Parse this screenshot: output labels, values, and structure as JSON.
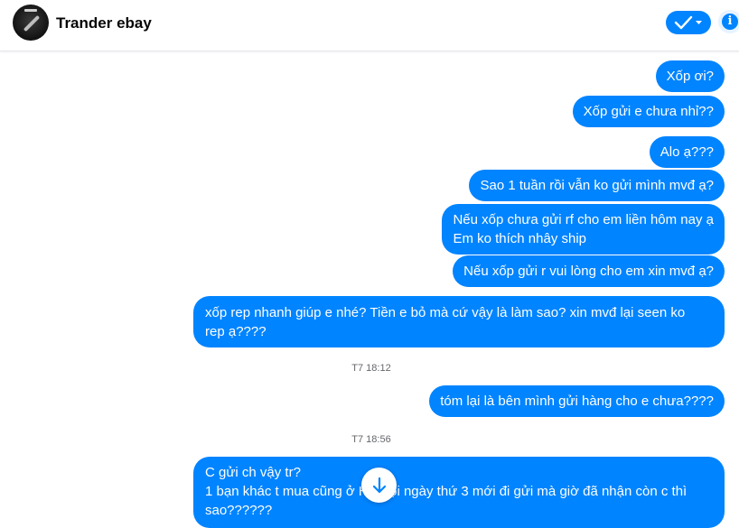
{
  "header": {
    "contact_name": "Trander ebay",
    "check_icon": "check-icon",
    "info_icon": "info-icon"
  },
  "colors": {
    "accent": "#0084ff",
    "timestamp": "#65676b"
  },
  "messages": [
    {
      "text": "Xốp ơi?"
    },
    {
      "text": "Xốp gửi e chưa nhỉ??"
    },
    {
      "text": "Alo ạ???"
    },
    {
      "text": "Sao 1 tuần rồi vẫn ko gửi mình mvđ ạ?"
    },
    {
      "lines": [
        "Nếu xốp chưa gửi rf cho em liền hôm nay ạ",
        "Em ko thích nhây ship"
      ]
    },
    {
      "text": "Nếu xốp gửi r vui lòng cho em xin mvđ ạ?"
    },
    {
      "text": "xốp rep nhanh giúp e nhé? Tiền e bỏ mà cứ vậy là làm sao? xin mvđ lại seen ko rep ạ????"
    },
    {
      "timestamp": "T7 18:12"
    },
    {
      "text": "tóm lại là bên mình gửi hàng cho e chưa????"
    },
    {
      "timestamp": "T7 18:56"
    },
    {
      "lines": [
        "C gửi ch vậy tr?",
        "1 bạn khác t mua cũng ở Hà Nội ngày thứ 3 mới đi gửi mà giờ đã nhận còn c thì sao??????"
      ]
    }
  ],
  "scroll_button": {
    "icon": "arrow-down-icon"
  }
}
